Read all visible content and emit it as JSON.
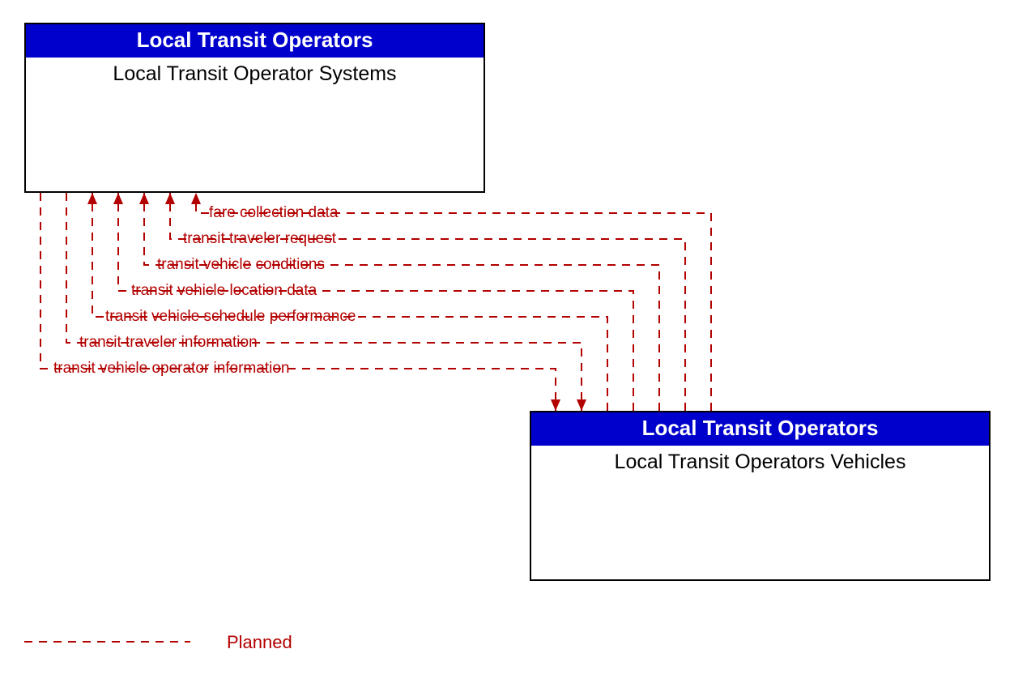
{
  "box_top": {
    "header": "Local Transit Operators",
    "title": "Local Transit Operator Systems"
  },
  "box_bottom": {
    "header": "Local Transit Operators",
    "title": "Local Transit Operators Vehicles"
  },
  "flows": {
    "f1": "fare collection data",
    "f2": "transit traveler request",
    "f3": "transit vehicle conditions",
    "f4": "transit vehicle location data",
    "f5": "transit vehicle schedule performance",
    "f6": "transit traveler information",
    "f7": "transit vehicle operator information"
  },
  "legend": {
    "planned": "Planned"
  }
}
